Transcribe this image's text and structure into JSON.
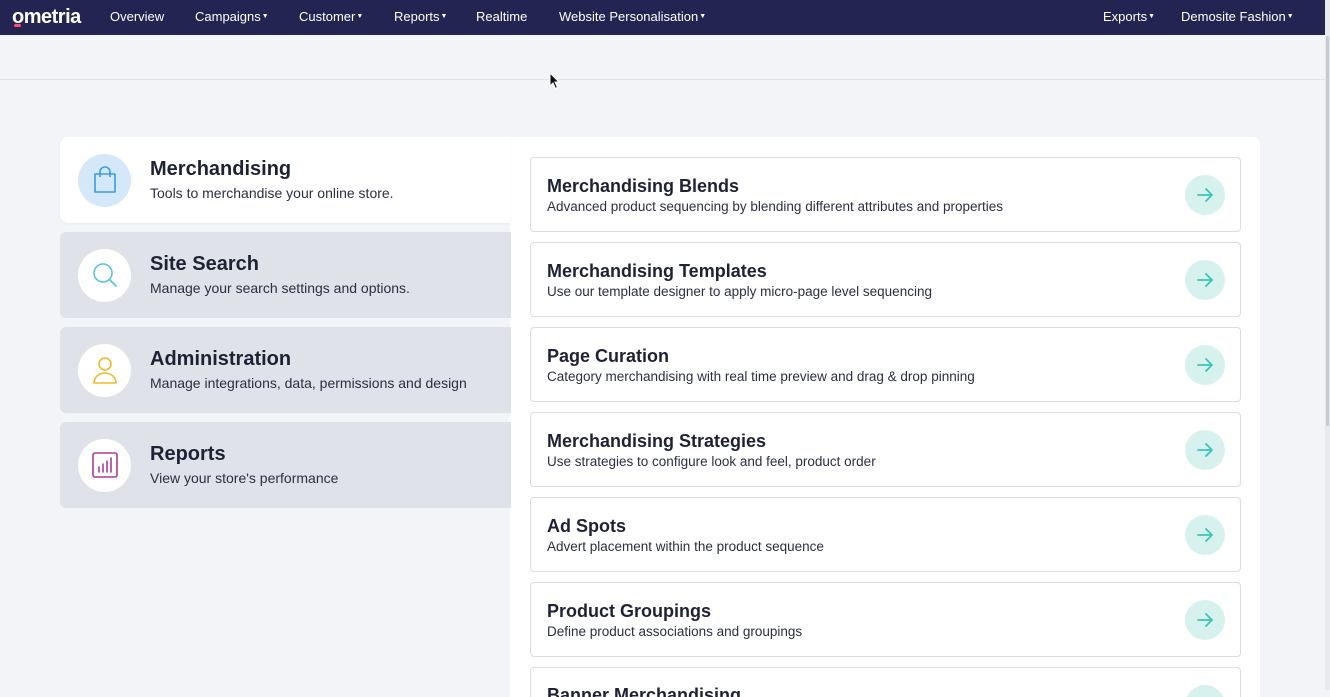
{
  "brand": {
    "name": "ometria",
    "accent": "#ff4d6d",
    "nav_bg": "#232452"
  },
  "nav": {
    "overview": "Overview",
    "campaigns": "Campaigns",
    "customer": "Customer",
    "reports": "Reports",
    "realtime": "Realtime",
    "personalisation": "Website Personalisation",
    "exports": "Exports",
    "account": "Demosite Fashion",
    "caret": "▼"
  },
  "categories": [
    {
      "title": "Merchandising",
      "desc": "Tools to merchandise your online store.",
      "icon": "shopping-bag-icon",
      "active": true
    },
    {
      "title": "Site Search",
      "desc": "Manage your search settings and options.",
      "icon": "search-icon",
      "active": false
    },
    {
      "title": "Administration",
      "desc": "Manage integrations, data, permissions and design",
      "icon": "user-icon",
      "active": false
    },
    {
      "title": "Reports",
      "desc": "View your store's performance",
      "icon": "bar-chart-icon",
      "active": false
    }
  ],
  "tools": [
    {
      "title": "Merchandising Blends",
      "desc": "Advanced product sequencing by blending different attributes and properties"
    },
    {
      "title": "Merchandising Templates",
      "desc": "Use our template designer to apply micro-page level sequencing"
    },
    {
      "title": "Page Curation",
      "desc": "Category merchandising with real time preview and drag & drop pinning"
    },
    {
      "title": "Merchandising Strategies",
      "desc": "Use strategies to configure look and feel, product order"
    },
    {
      "title": "Ad Spots",
      "desc": "Advert placement within the product sequence"
    },
    {
      "title": "Product Groupings",
      "desc": "Define product associations and groupings"
    },
    {
      "title": "Banner Merchandising",
      "desc": ""
    }
  ],
  "colors": {
    "arrow_bg": "#d7f2ee",
    "arrow_fg": "#3cc4b4"
  }
}
